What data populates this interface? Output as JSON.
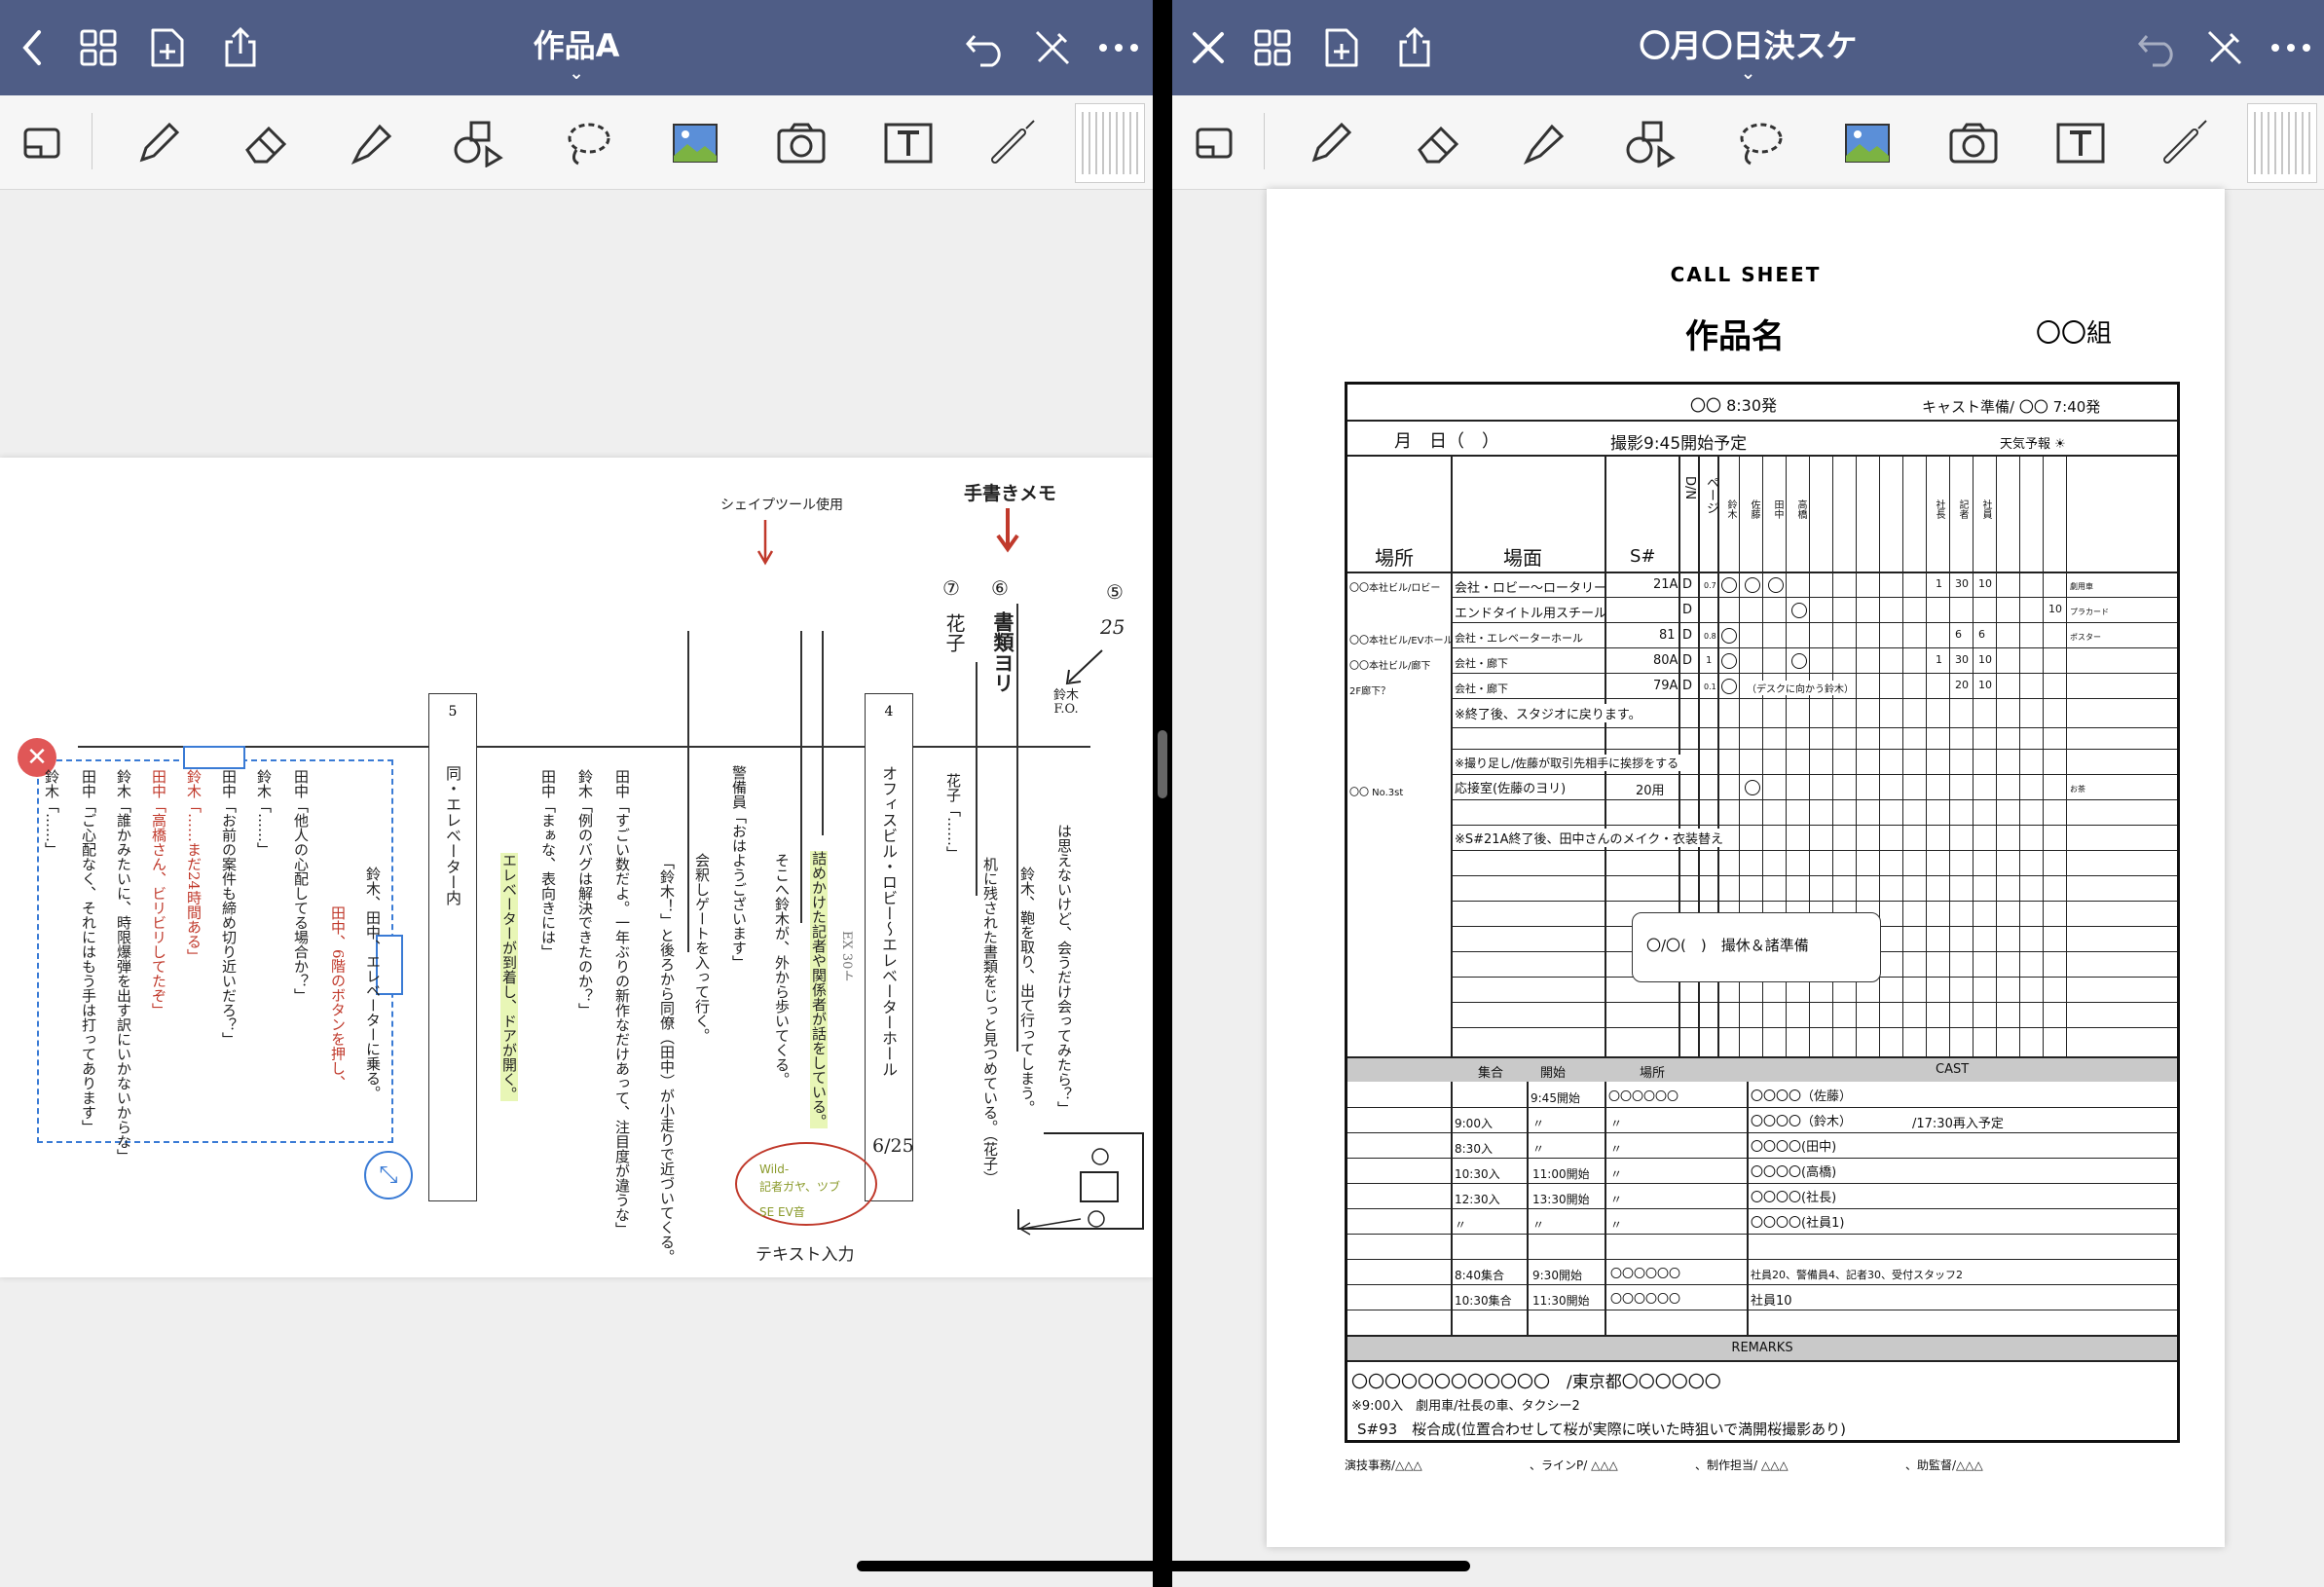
{
  "left": {
    "title": "作品A",
    "script": {
      "scene_left_num": "5",
      "scene_left_place": "同・エレベーター内",
      "scene_right_num": "4",
      "scene_right_place": "オフィスビル・ロビー〜エレベーターホール",
      "lines": [
        "田中「他人の心配してる場合か？」",
        "鈴木「……」",
        "田中「お前の案件も締め切り近いだろ？」",
        "鈴木「……まだ24時間ある」",
        "田中「高橋さん、ビリビリしてたぞ」",
        "鈴木「誰かみたいに、時限爆弾を出す訳にいかないからな」",
        "田中「ご心配なく、それにはもう手は打ってあります」",
        "鈴木「……」"
      ],
      "action_1": "鈴木、田中、エレベーターに乗る。",
      "action_1b": "田中、6階のボタンを押し、",
      "elevator_arrive": "エレベーターが到着し、ドアが開く。",
      "tanaka_1": "田中「まぁな、表向きには」",
      "suzuki_1": "鈴木「例のバグは解決できたのか？」",
      "tanaka_2": "田中「すごい数だよ。一年ぶりの新作なだけあって、注目度が違うな」",
      "suzuki_2": "「鈴木！」と後ろから同僚（田中）が小走りで近づいてくる。",
      "gate": "会釈しゲートを入って行く。",
      "guard": "警備員「おはようございます」",
      "suzuki_enter": "そこへ鈴木が、外から歩いてくる。",
      "reporters": "詰めかけた記者や関係者が話をしている。",
      "hanako_label": "花子「……」",
      "desk": "机に残された書類をじっと見つめている。（花子）",
      "suzuki_bag": "鈴木、鞄を取り、出て行ってしまう。",
      "think": "は思えないけど、会うだけ会ってみたら？」",
      "note_shape": "シェイプツール使用",
      "note_hand": "手書きメモ",
      "note_text": "テキスト入力",
      "bubble_1": "Wild-",
      "bubble_2": "記者ガヤ、ツブ",
      "bubble_3": "SE EV音",
      "ex_note": "EX 30ト",
      "date_note": "6/25",
      "hand_7": "⑦",
      "hand_6": "⑥",
      "hand_5": "⑤",
      "hand_hanako": "花子",
      "hand_docs": "書類ヨリ",
      "hand_25": "25",
      "hand_suzuki_fo": "鈴木 F.O."
    }
  },
  "right": {
    "title": "〇月〇日決スケ",
    "sheet": {
      "heading": "CALL SHEET",
      "work_name": "作品名",
      "group": "〇〇組",
      "depart": "〇〇 8:30発",
      "cast_prep": "キャスト準備/ 〇〇 7:40発",
      "date": "月　日（　）",
      "shoot_start": "撮影9:45開始予定",
      "weather": "天気予報 ☀",
      "col_place": "場所",
      "col_scene": "場面",
      "col_s": "S#",
      "col_dn": "D/N",
      "col_page": "ページ",
      "col_cast": [
        "鈴木",
        "佐藤",
        "田中",
        "高橋"
      ],
      "col_extra": [
        "社長",
        "記者",
        "社員"
      ],
      "rows": [
        {
          "place": "〇〇本社ビル/ロビー",
          "scene": "会社・ロビー〜ロータリー",
          "s": "21A",
          "dn": "D",
          "page": "0.7",
          "c1": "〇",
          "c2": "〇",
          "c3": "〇",
          "e1": "1",
          "e2": "30",
          "e3": "10",
          "note": "劇用車"
        },
        {
          "place": "",
          "scene": "エンドタイトル用スチール",
          "s": "",
          "dn": "D",
          "page": "",
          "c1": "",
          "c2": "",
          "c3": "",
          "c4": "〇",
          "e1": "",
          "e2": "",
          "e3": "10",
          "note": "プラカード"
        },
        {
          "place": "〇〇本社ビル/EVホール",
          "scene": "会社・エレベーターホール",
          "s": "81",
          "dn": "D",
          "page": "0.8",
          "c1": "〇",
          "e1": "",
          "e2": "6",
          "e3": "6",
          "note": "ポスター"
        },
        {
          "place": "〇〇本社ビル/廊下",
          "scene": "会社・廊下",
          "s": "80A",
          "dn": "D",
          "page": "1",
          "c1": "〇",
          "c4": "〇",
          "e1": "1",
          "e2": "30",
          "e3": "10",
          "note": ""
        },
        {
          "place": "2F廊下？",
          "scene": "会社・廊下",
          "s": "79A",
          "dn": "D",
          "page": "0.1",
          "c1": "〇",
          "sub": "（デスクに向かう鈴木）",
          "e2": "20",
          "e3": "10",
          "note": ""
        }
      ],
      "note_1": "※終了後、スタジオに戻ります。",
      "note_2": "※撮り足し/佐藤が取引先相手に挨拶をする",
      "row_office_place": "〇〇 No.3st",
      "row_office_scene": "応接室(佐藤のヨリ)",
      "row_office_s": "20用",
      "row_office_note": "お茶",
      "note_3": "※S#21A終了後、田中さんのメイク・衣装替え",
      "holiday": "〇/〇(　)　撮休＆諸準備",
      "cast_head": [
        "集合",
        "開始",
        "場所",
        "CAST"
      ],
      "cast_rows": [
        {
          "meet": "",
          "start": "9:45開始",
          "place": "〇〇〇〇〇〇",
          "cast": "〇〇〇〇（佐藤）",
          "memo": ""
        },
        {
          "meet": "9:00入",
          "start": "〃",
          "place": "〃",
          "cast": "〇〇〇〇（鈴木）",
          "memo": "/17:30再入予定"
        },
        {
          "meet": "8:30入",
          "start": "〃",
          "place": "〃",
          "cast": "〇〇〇〇(田中)",
          "memo": ""
        },
        {
          "meet": "10:30入",
          "start": "11:00開始",
          "place": "〃",
          "cast": "〇〇〇〇(高橋)",
          "memo": ""
        },
        {
          "meet": "12:30入",
          "start": "13:30開始",
          "place": "〃",
          "cast": "〇〇〇〇(社長)",
          "memo": ""
        },
        {
          "meet": "〃",
          "start": "〃",
          "place": "〃",
          "cast": "〇〇〇〇(社員1)",
          "memo": ""
        },
        {
          "meet": "",
          "start": "",
          "place": "",
          "cast": "",
          "memo": ""
        },
        {
          "meet": "8:40集合",
          "start": "9:30開始",
          "place": "〇〇〇〇〇〇",
          "cast": "社員20、警備員4、記者30、受付スタッフ2",
          "memo": ""
        },
        {
          "meet": "10:30集合",
          "start": "11:30開始",
          "place": "〇〇〇〇〇〇",
          "cast": "社員10",
          "memo": ""
        }
      ],
      "remarks_head": "REMARKS",
      "remarks": [
        "〇〇〇〇〇〇〇〇〇〇〇〇　/東京都〇〇〇〇〇〇",
        "※9:00入　劇用車/社長の車、タクシー2",
        "S#93　桜合成(位置合わせして桜が実際に咲いた時狙いで満開桜撮影あり)"
      ],
      "footer": [
        "演技事務/△△△",
        "、ラインP/ △△△",
        "、制作担当/ △△△",
        "、助監督/△△△"
      ]
    }
  },
  "icons": {
    "back": "chevron-left-icon",
    "close": "close-icon",
    "grid": "grid-icon",
    "add_page": "add-page-icon",
    "share": "share-icon",
    "undo": "undo-icon",
    "no_pen": "pencil-off-icon",
    "more": "more-icon"
  },
  "colors": {
    "topbar": "#4f5d86",
    "accent_red": "#c0392b",
    "selection_blue": "#3a7bd5"
  }
}
